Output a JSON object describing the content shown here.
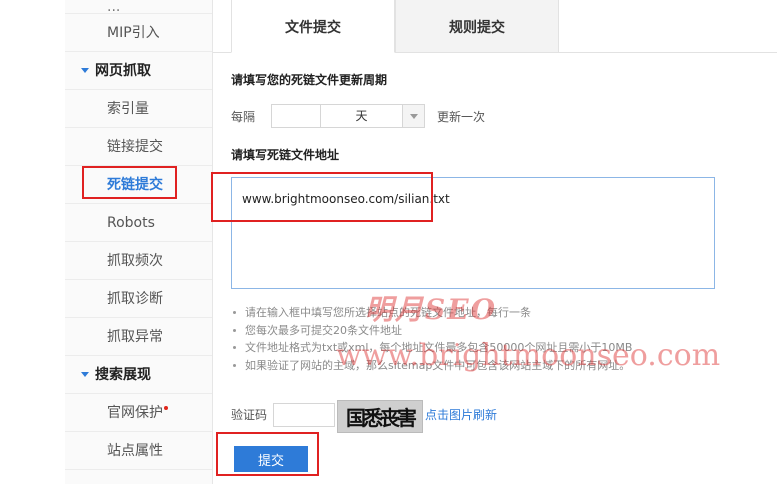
{
  "sidebar": {
    "clipped_item": "...",
    "items_top": [
      "MIP引入"
    ],
    "group_crawl": "网页抓取",
    "crawl_items": [
      "索引量",
      "链接提交",
      "死链提交",
      "Robots",
      "抓取频次",
      "抓取诊断",
      "抓取异常"
    ],
    "active_item": "死链提交",
    "group_display": "搜索展现",
    "display_items": [
      "官网保护",
      "站点属性"
    ]
  },
  "tabs": {
    "file_submit": "文件提交",
    "rule_submit": "规则提交"
  },
  "form": {
    "period_title": "请填写您的死链文件更新周期",
    "every_label": "每隔",
    "period_value": "",
    "period_unit": "天",
    "period_suffix": "更新一次",
    "url_title": "请填写死链文件地址",
    "url_value": "www.brightmoonseo.com/silian.txt",
    "tips": [
      "请在输入框中填写您所选择站点的死链文件地址，每行一条",
      "您每次最多可提交20条文件地址",
      "文件地址格式为txt或xml，每个地址文件最多包含50000个网址且需小于10MB",
      "如果验证了网站的主域，那么sitemap文件中可包含该网站主域下的所有网址。"
    ],
    "captcha_label": "验证码",
    "captcha_value": "",
    "captcha_text": "国悉丧害",
    "refresh_label": "点击图片刷新",
    "submit_label": "提交"
  },
  "watermark": {
    "line1": "明月SEO",
    "line2": "www.brightmoonseo.com"
  },
  "colors": {
    "accent": "#2e7bd8",
    "highlight": "#e02121"
  }
}
